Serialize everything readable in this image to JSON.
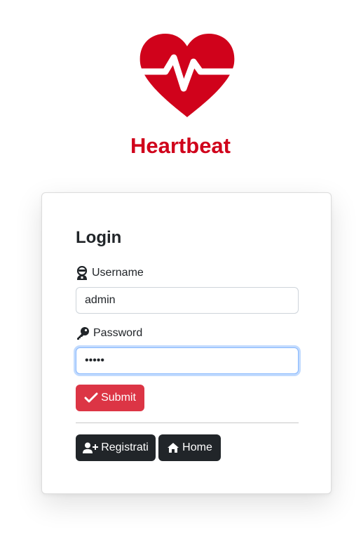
{
  "brand": {
    "name": "Heartbeat",
    "logo_icon": "heart-pulse-icon",
    "color": "#d0021b"
  },
  "login": {
    "title": "Login",
    "username": {
      "label": "Username",
      "icon": "user-icon",
      "value": "admin"
    },
    "password": {
      "label": "Password",
      "icon": "key-icon",
      "value": "admin"
    },
    "submit": {
      "label": "Submit",
      "icon": "check-icon",
      "color": "#dc3545"
    }
  },
  "footer_actions": {
    "register": {
      "label": "Registrati",
      "icon": "user-plus-icon"
    },
    "home": {
      "label": "Home",
      "icon": "home-icon"
    },
    "color": "#212529"
  }
}
